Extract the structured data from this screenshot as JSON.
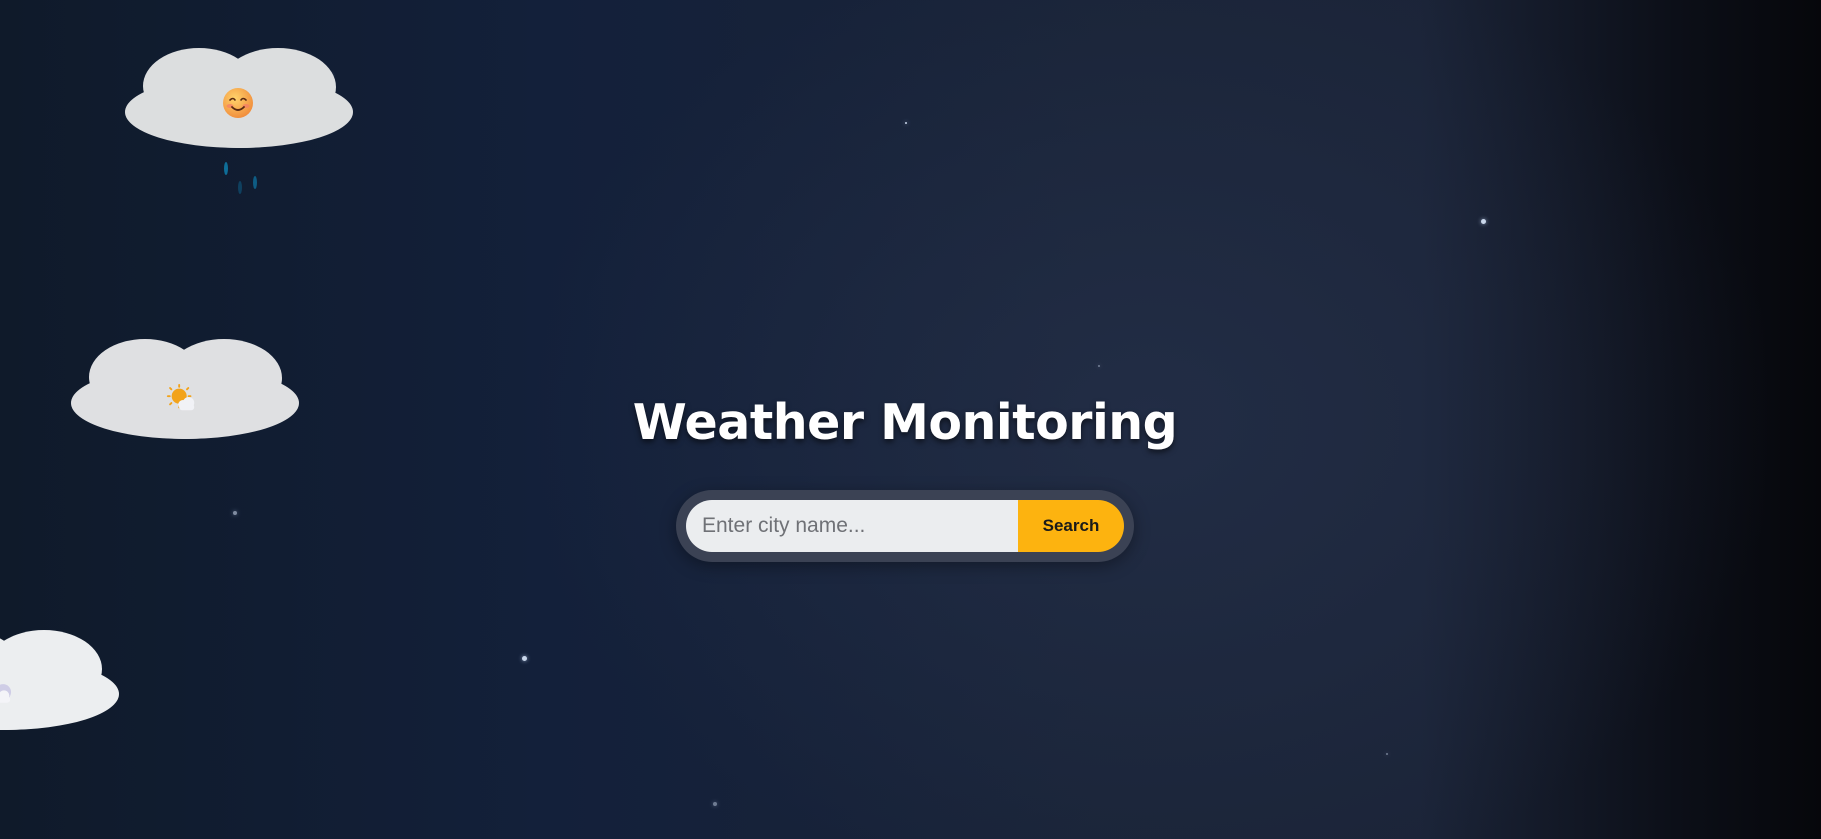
{
  "page": {
    "title": "Weather Monitoring"
  },
  "search": {
    "placeholder": "Enter city name...",
    "value": "",
    "button_label": "Search"
  },
  "clouds": [
    {
      "icon": "smiling-face-icon"
    },
    {
      "icon": "sun-behind-cloud-icon"
    },
    {
      "icon": "moon-cloud-icon"
    }
  ],
  "colors": {
    "accent": "#fdb30f",
    "background": "#13203a",
    "cloud": "#e3e4e6",
    "rain": "#0e6d98"
  }
}
